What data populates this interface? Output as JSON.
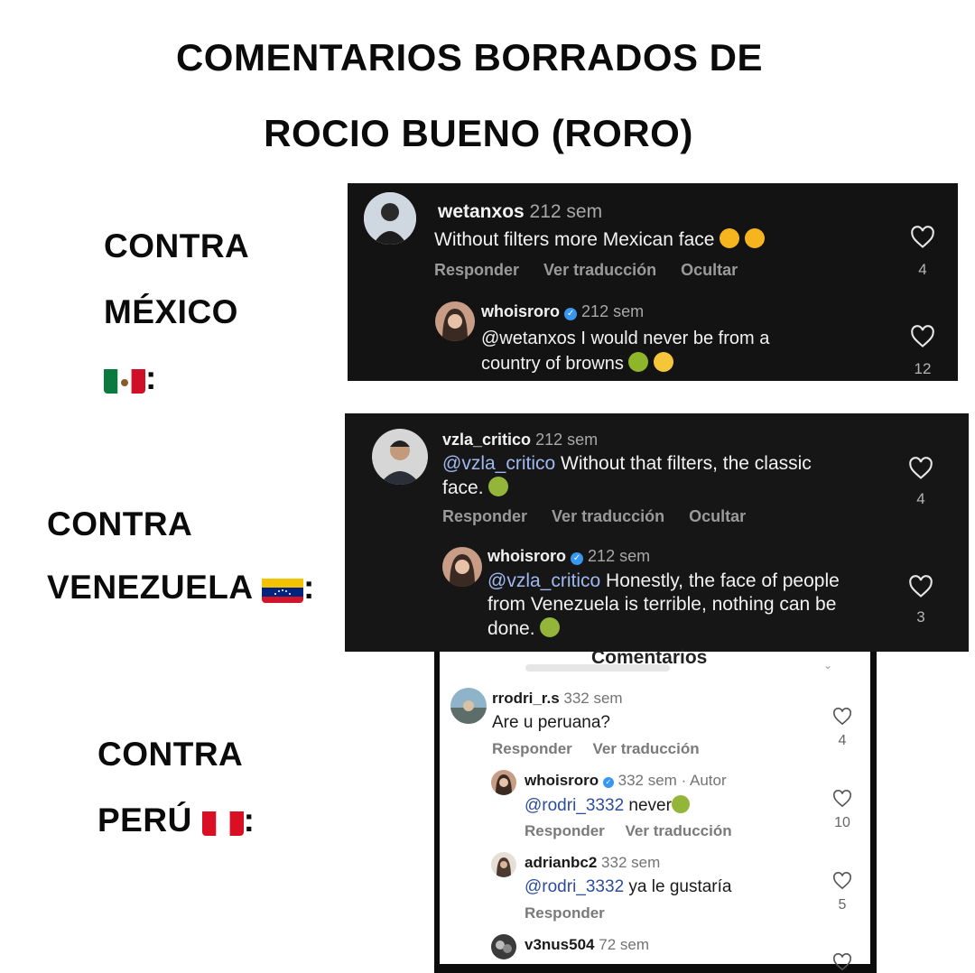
{
  "title": {
    "line1": "COMENTARIOS BORRADOS DE",
    "line2": "ROCIO BUENO (RORO)"
  },
  "sections": {
    "mexico": {
      "line1": "CONTRA",
      "line2": "MÉXICO",
      "colon": ":"
    },
    "venezuela": {
      "line1": "CONTRA",
      "line2": "VENEZUELA",
      "colon": ":"
    },
    "peru": {
      "line1": "CONTRA",
      "line2": "PERÚ",
      "colon": ":"
    }
  },
  "panel1": {
    "comment": {
      "username": "wetanxos",
      "time": "212 sem",
      "text": "Without filters more Mexican face",
      "actions": [
        "Responder",
        "Ver traducción",
        "Ocultar"
      ],
      "likes": "4"
    },
    "reply": {
      "username": "whoisroro",
      "time": "212 sem",
      "mention": "@wetanxos",
      "text_line1": " I would never be from a",
      "text_line2": "country of browns",
      "likes": "12"
    }
  },
  "panel2": {
    "comment": {
      "username": "vzla_critico",
      "time": "212 sem",
      "mention": "@vzla_critico",
      "text_line1": " Without that filters, the classic",
      "text_line2": "face.",
      "actions": [
        "Responder",
        "Ver traducción",
        "Ocultar"
      ],
      "likes": "4"
    },
    "reply": {
      "username": "whoisroro",
      "time": "212 sem",
      "mention": "@vzla_critico",
      "text_line1": " Honestly, the face of people",
      "text_line2": "from Venezuela is terrible, nothing can be",
      "text_line3": "done.",
      "likes": "3"
    }
  },
  "panel3": {
    "header": "Comentarios",
    "comments": [
      {
        "username": "rrodri_r.s",
        "time": "332 sem",
        "text": "Are u peruana?",
        "actions": [
          "Responder",
          "Ver traducción"
        ],
        "likes": "4"
      },
      {
        "username": "whoisroro",
        "time": "332 sem · Autor",
        "mention": "@rodri_3332",
        "text": " never",
        "actions": [
          "Responder",
          "Ver traducción"
        ],
        "likes": "10"
      },
      {
        "username": "adrianbc2",
        "time": "332 sem",
        "mention": "@rodri_3332",
        "text": " ya le gustaría",
        "actions": [
          "Responder"
        ],
        "likes": "5"
      },
      {
        "username": "v3nus504",
        "time": "72 sem"
      }
    ]
  },
  "colors": {
    "dark_panel": "#131313",
    "mention_dark": "#9fb8f0",
    "mention_light": "#2c4c9c",
    "verified": "#3897f0"
  },
  "icons": [
    "heart-icon",
    "verified-icon",
    "flag-mexico-icon",
    "flag-venezuela-icon",
    "flag-peru-icon",
    "tired-face-emoji",
    "nauseated-face-emoji",
    "vomiting-face-emoji",
    "laughing-emoji"
  ]
}
